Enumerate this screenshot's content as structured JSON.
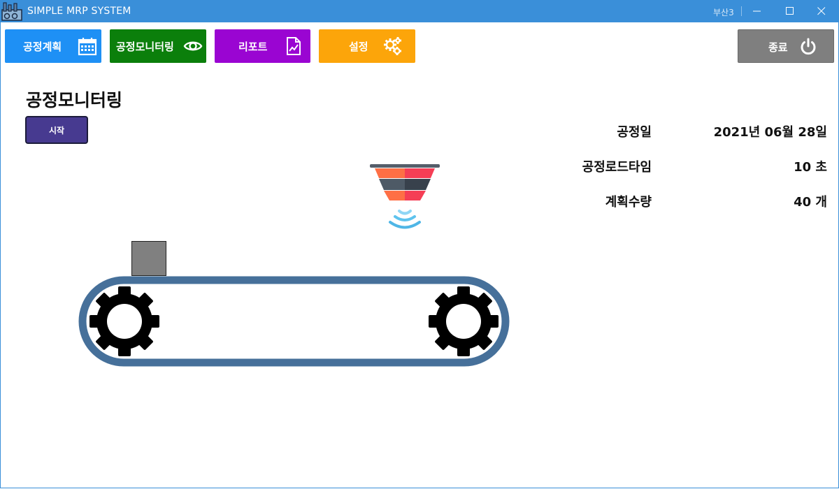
{
  "window": {
    "title": "SIMPLE MRP SYSTEM",
    "user": "부산3"
  },
  "nav": {
    "plan_label": "공정계획",
    "monitor_label": "공정모니터링",
    "report_label": "리포트",
    "settings_label": "설정",
    "exit_label": "종료"
  },
  "main": {
    "title": "공정모니터링",
    "start_label": "시작"
  },
  "info": {
    "date_label": "공정일",
    "date_value": "2021년 06월 28일",
    "load_time_label": "공정로드타임",
    "load_time_value": "10 초",
    "quantity_label": "계획수량",
    "quantity_value": "40 개"
  },
  "colors": {
    "titlebar": "#3a8fd9",
    "plan": "#1e90f5",
    "monitor": "#0b7f0b",
    "report": "#9a05d2",
    "settings": "#fca50a",
    "exit": "#7f7f7f",
    "start": "#473a90",
    "belt": "#46709a",
    "product": "#808080"
  },
  "icons": {
    "app": "factory-icon",
    "plan": "calendar-icon",
    "monitor": "eye-icon",
    "report": "document-chart-icon",
    "settings": "gears-icon",
    "exit": "power-icon",
    "sensor": "sensor-icon"
  }
}
